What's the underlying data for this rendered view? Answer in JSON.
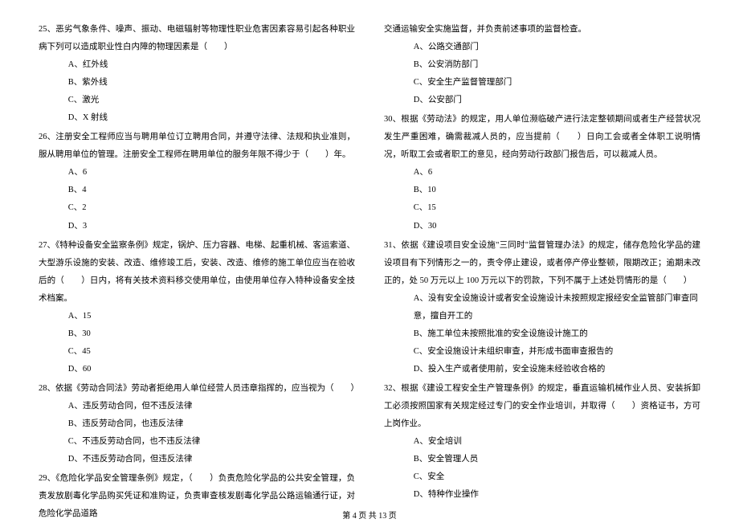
{
  "left": {
    "q25": {
      "stem": "25、恶劣气象条件、噪声、振动、电磁辐射等物理性职业危害因素容易引起各种职业病下列可以造成职业性白内障的物理因素是（　　）",
      "a": "A、红外线",
      "b": "B、紫外线",
      "c": "C、激光",
      "d": "D、X 射线"
    },
    "q26": {
      "stem": "26、注册安全工程师应当与聘用单位订立聘用合同，并遵守法律、法规和执业准则，服从聘用单位的管理。注册安全工程师在聘用单位的服务年限不得少于（　　）年。",
      "a": "A、6",
      "b": "B、4",
      "c": "C、2",
      "d": "D、3"
    },
    "q27": {
      "stem": "27、《特种设备安全监察条例》规定，锅炉、压力容器、电梯、起重机械、客运索道、大型游乐设施的安装、改造、维修竣工后，安装、改造、维修的施工单位应当在验收后的（　　）日内，将有关技术资料移交使用单位，由使用单位存入特种设备安全技术档案。",
      "a": "A、15",
      "b": "B、30",
      "c": "C、45",
      "d": "D、60"
    },
    "q28": {
      "stem": "28、依据《劳动合同法》劳动者拒绝用人单位经营人员违章指挥的，应当视为（　　）",
      "a": "A、违反劳动合同，但不违反法律",
      "b": "B、违反劳动合同，也违反法律",
      "c": "C、不违反劳动合同，也不违反法律",
      "d": "D、不违反劳动合同，但违反法律"
    },
    "q29": {
      "stem": "29、《危险化学品安全管理条例》规定，（　　）负责危险化学品的公共安全管理，负责发放剧毒化学品购买凭证和准购证，负责审查核发剧毒化学品公路运输通行证，对危险化学品道路"
    }
  },
  "right": {
    "q29cont": {
      "stem": "交通运输安全实施监督，并负责前述事项的监督检查。",
      "a": "A、公路交通部门",
      "b": "B、公安消防部门",
      "c": "C、安全生产监督管理部门",
      "d": "D、公安部门"
    },
    "q30": {
      "stem": "30、根据《劳动法》的规定，用人单位濒临破产进行法定整顿期间或者生产经营状况发生严重困难，确需裁减人员的，应当提前（　　）日向工会或者全体职工说明情况，听取工会或者职工的意见，经向劳动行政部门报告后，可以裁减人员。",
      "a": "A、6",
      "b": "B、10",
      "c": "C、15",
      "d": "D、30"
    },
    "q31": {
      "stem": "31、依据《建设项目安全设施\"三同时\"监督管理办法》的规定，储存危险化学品的建设项目有下列情形之一的，责令停止建设，或者停产停业整顿，限期改正；逾期未改正的，处 50 万元以上 100 万元以下的罚款，下列不属于上述处罚情形的是（　　）",
      "a": "A、没有安全设施设计或者安全设施设计未按照规定报经安全监管部门审查同意，擅自开工的",
      "b": "B、施工单位未按照批准的安全设施设计施工的",
      "c": "C、安全设施设计未组织审查，并形成书面审查报告的",
      "d": "D、投入生产或者使用前，安全设施未经验收合格的"
    },
    "q32": {
      "stem": "32、根据《建设工程安全生产管理条例》的规定，垂直运输机械作业人员、安装拆卸工必须按照国家有关规定经过专门的安全作业培训，并取得（　　）资格证书，方可上岗作业。",
      "a": "A、安全培训",
      "b": "B、安全管理人员",
      "c": "C、安全",
      "d": "D、特种作业操作"
    }
  },
  "footer": "第 4 页 共 13 页"
}
